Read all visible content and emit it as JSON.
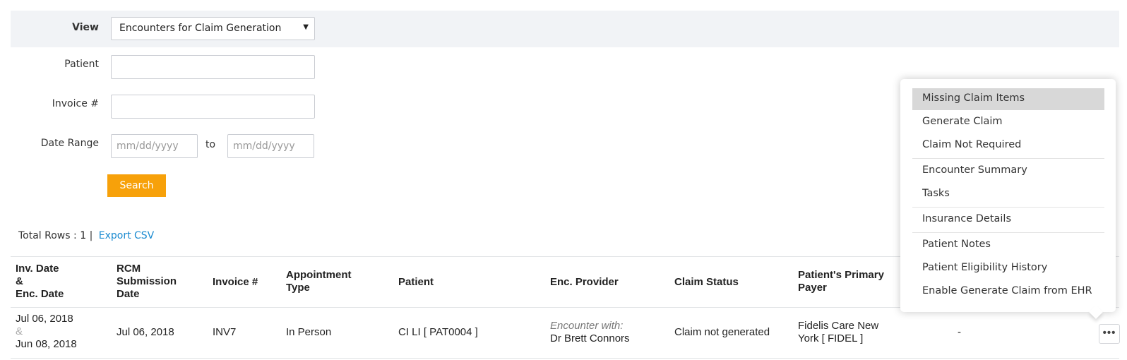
{
  "filters": {
    "view_label": "View",
    "view_value": "Encounters for Claim Generation",
    "patient_label": "Patient",
    "patient_value": "",
    "invoice_label": "Invoice #",
    "invoice_value": "",
    "date_range_label": "Date Range",
    "date_from_placeholder": "mm/dd/yyyy",
    "date_to_label": "to",
    "date_to_placeholder": "mm/dd/yyyy",
    "search_label": "Search"
  },
  "summary": {
    "total_rows_label": "Total Rows :",
    "total_rows_value": "1",
    "separator": "|",
    "export_label": "Export CSV"
  },
  "table": {
    "headers": {
      "inv_date": [
        "Inv. Date",
        "&",
        "Enc. Date"
      ],
      "rcm": [
        "RCM",
        "Submission",
        "Date"
      ],
      "invoice": "Invoice #",
      "appt_type": [
        "Appointment",
        "Type"
      ],
      "patient": "Patient",
      "enc_provider": "Enc. Provider",
      "claim_status": "Claim Status",
      "primary_payer": [
        "Patient's Primary",
        "Payer"
      ]
    },
    "rows": [
      {
        "inv_date": "Jul 06, 2018",
        "amp": "&",
        "enc_date": "Jun 08, 2018",
        "rcm_date": "Jul 06, 2018",
        "invoice": "INV7",
        "appt_type": "In Person",
        "patient": "CI LI [ PAT0004 ]",
        "enc_with": "Encounter with:",
        "provider": "Dr Brett Connors",
        "claim_status": "Claim not generated",
        "payer_line1": "Fidelis Care New",
        "payer_line2": "York [ FIDEL ]",
        "extra": "-",
        "actions_icon": "•••"
      }
    ]
  },
  "menu": {
    "items": [
      "Missing Claim Items",
      "Generate Claim",
      "Claim Not Required",
      "Encounter Summary",
      "Tasks",
      "Insurance Details",
      "Patient Notes",
      "Patient Eligibility History",
      "Enable Generate Claim from EHR"
    ],
    "active_index": 0
  },
  "colors": {
    "accent_button": "#f7a10a",
    "link": "#1a8ad0",
    "filter_band": "#f1f3f6",
    "menu_active": "#d8d8d8"
  },
  "icons": {
    "actions": "more-horizontal-icon",
    "select_caret": "caret-down-icon"
  }
}
